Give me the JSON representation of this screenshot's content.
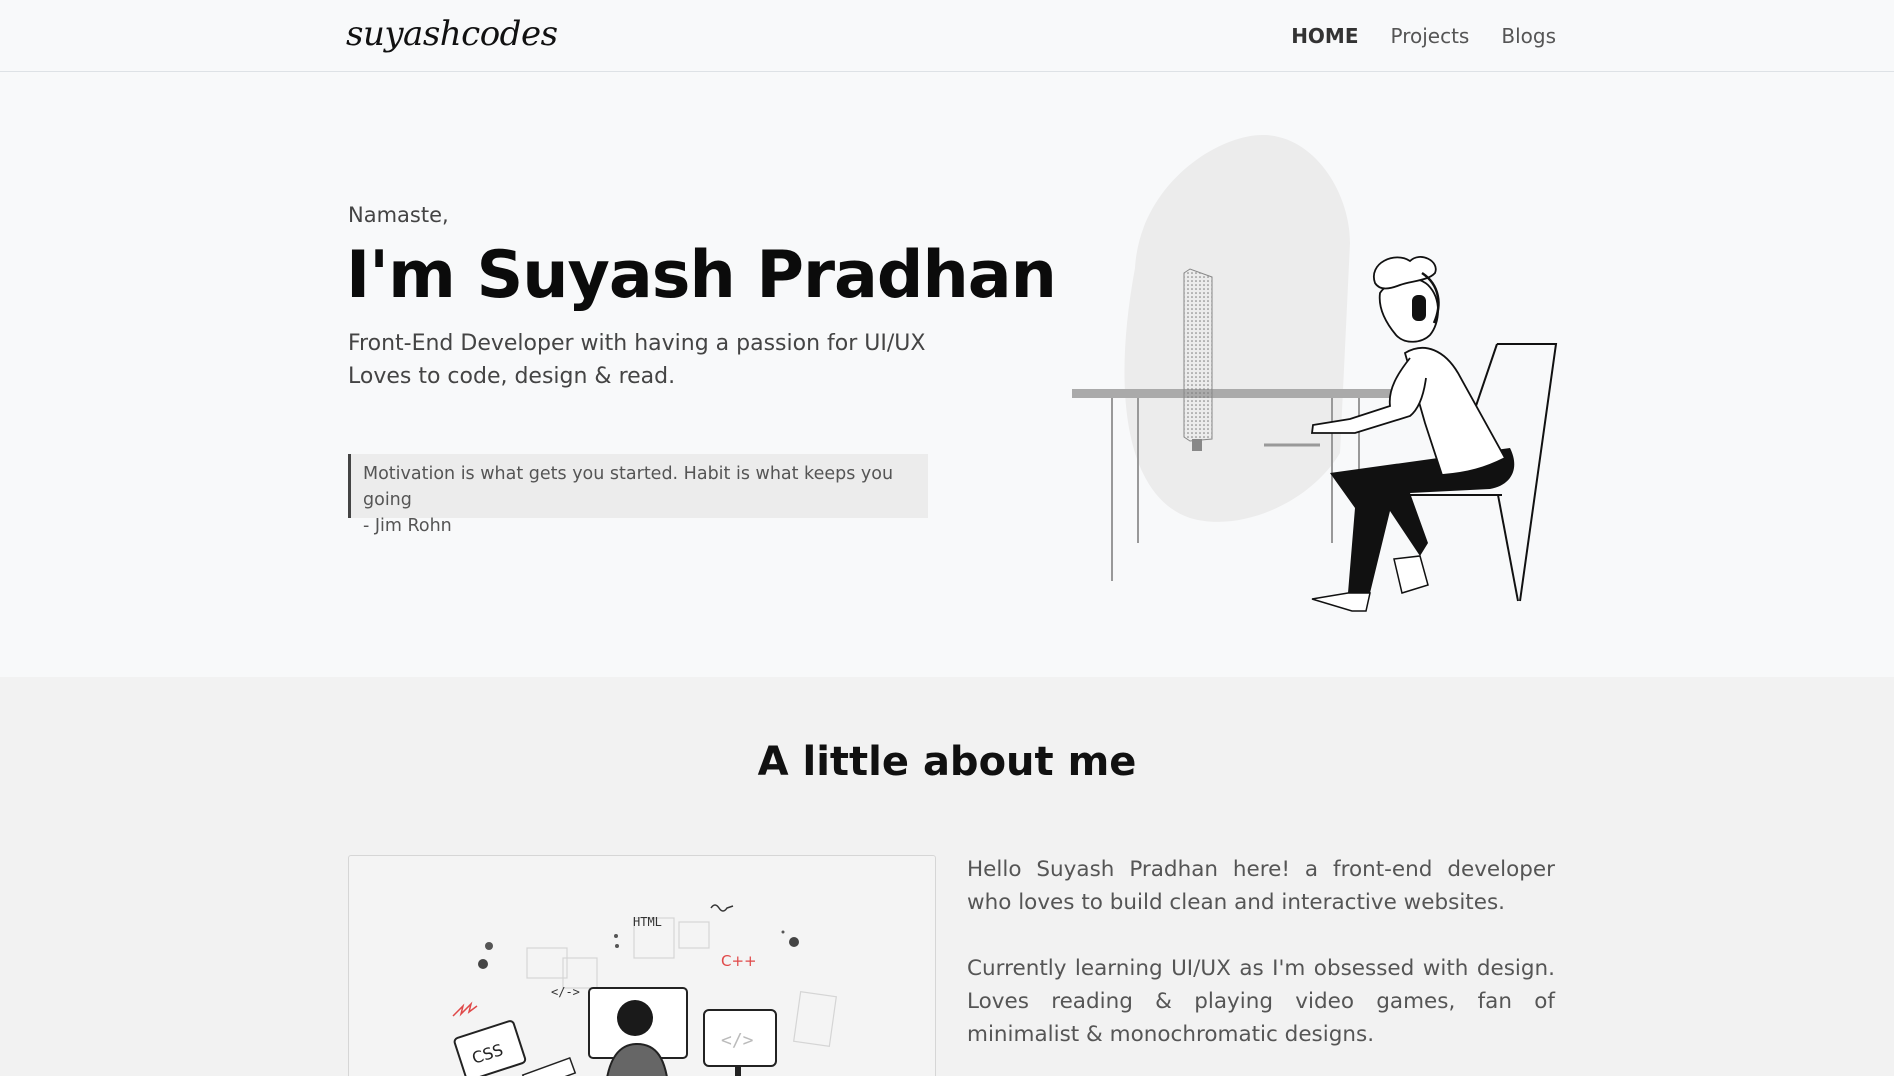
{
  "nav": {
    "brand": "suyashcodes",
    "links": [
      {
        "label": "HOME",
        "active": true
      },
      {
        "label": "Projects",
        "active": false
      },
      {
        "label": "Blogs",
        "active": false
      }
    ]
  },
  "hero": {
    "greeting": "Namaste,",
    "title": "I'm Suyash Pradhan",
    "subtitle_line1": "Front-End Developer with having a passion for UI/UX",
    "subtitle_line2": "Loves to code, design & read.",
    "quote_text": "Motivation is what gets you started. Habit is what keeps you going",
    "quote_author": "- Jim Rohn"
  },
  "about": {
    "title": "A little about me",
    "paragraph1": "Hello Suyash Pradhan here! a front-end developer who loves to build clean and interactive websites.",
    "paragraph2": "Currently learning UI/UX as I'm obsessed with design. Loves reading & playing video games, fan of minimalist & monochromatic designs.",
    "illustration_labels": {
      "html": "HTML",
      "cpp": "C++",
      "css": "CSS",
      "tag": "</->"
    }
  },
  "colors": {
    "page_bg": "#f8f9fa",
    "about_bg": "#f2f2f2",
    "accent_red": "#e04848"
  }
}
